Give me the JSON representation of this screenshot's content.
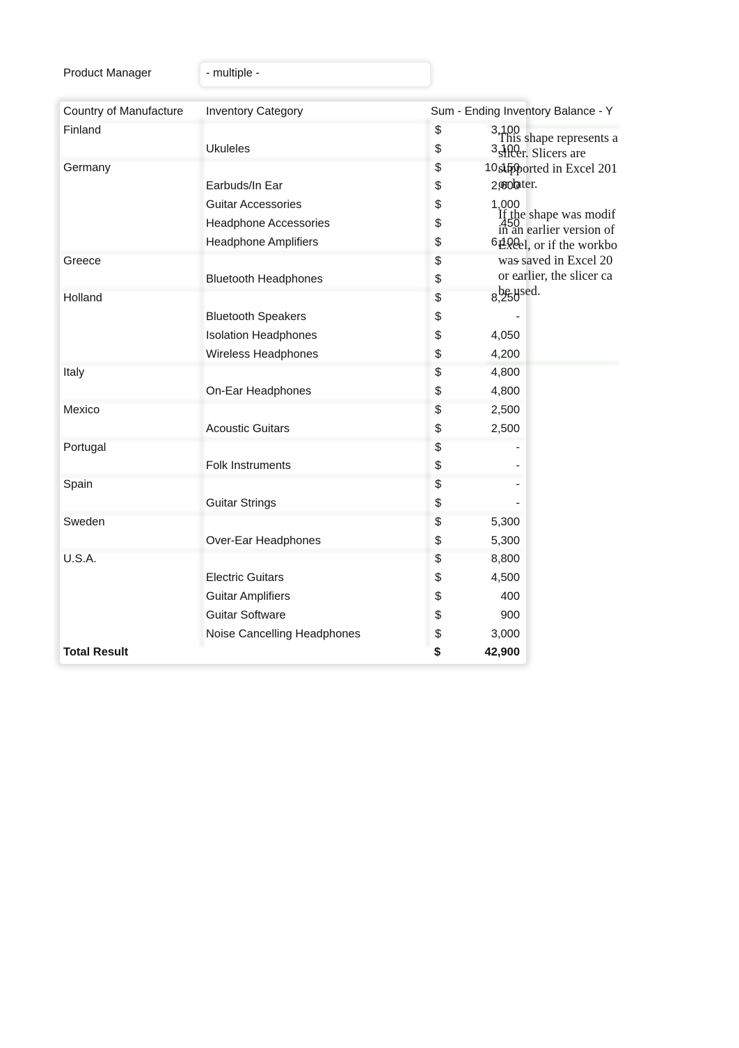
{
  "filter": {
    "label": "Product Manager",
    "value": "- multiple -"
  },
  "pivot": {
    "headers": {
      "country": "Country of Manufacture",
      "category": "Inventory Category",
      "sum": "Sum - Ending Inventory Balance - Y"
    },
    "currency_symbol": "$",
    "rows": [
      {
        "country": "Finland",
        "category": "",
        "value": "3,100"
      },
      {
        "country": "",
        "category": "Ukuleles",
        "value": "3,100"
      },
      {
        "country": "Germany",
        "category": "",
        "value": "10,150"
      },
      {
        "country": "",
        "category": "Earbuds/In Ear",
        "value": "2,600"
      },
      {
        "country": "",
        "category": "Guitar Accessories",
        "value": "1,000"
      },
      {
        "country": "",
        "category": "Headphone Accessories",
        "value": "450"
      },
      {
        "country": "",
        "category": "Headphone Amplifiers",
        "value": "6,100"
      },
      {
        "country": "Greece",
        "category": "",
        "value": "-"
      },
      {
        "country": "",
        "category": "Bluetooth Headphones",
        "value": "-"
      },
      {
        "country": "Holland",
        "category": "",
        "value": "8,250"
      },
      {
        "country": "",
        "category": "Bluetooth Speakers",
        "value": "-"
      },
      {
        "country": "",
        "category": "Isolation Headphones",
        "value": "4,050"
      },
      {
        "country": "",
        "category": "Wireless Headphones",
        "value": "4,200"
      },
      {
        "country": "Italy",
        "category": "",
        "value": "4,800"
      },
      {
        "country": "",
        "category": "On-Ear Headphones",
        "value": "4,800"
      },
      {
        "country": "Mexico",
        "category": "",
        "value": "2,500"
      },
      {
        "country": "",
        "category": "Acoustic Guitars",
        "value": "2,500"
      },
      {
        "country": "Portugal",
        "category": "",
        "value": "-"
      },
      {
        "country": "",
        "category": "Folk Instruments",
        "value": "-"
      },
      {
        "country": "Spain",
        "category": "",
        "value": "-"
      },
      {
        "country": "",
        "category": "Guitar Strings",
        "value": "-"
      },
      {
        "country": "Sweden",
        "category": "",
        "value": "5,300"
      },
      {
        "country": "",
        "category": "Over-Ear Headphones",
        "value": "5,300"
      },
      {
        "country": "U.S.A.",
        "category": "",
        "value": "8,800"
      },
      {
        "country": "",
        "category": "Electric Guitars",
        "value": "4,500"
      },
      {
        "country": "",
        "category": "Guitar Amplifiers",
        "value": "400"
      },
      {
        "country": "",
        "category": "Guitar Software",
        "value": "900"
      },
      {
        "country": "",
        "category": "Noise Cancelling Headphones",
        "value": "3,000"
      }
    ],
    "total": {
      "label": "Total Result",
      "value": "42,900"
    }
  },
  "slicer_placeholder": "This shape represents a\nslicer. Slicers are\nsupported in Excel 201\nor later.\n\nIf the shape was modif\nin an earlier version of\nExcel, or if the workbo\nwas saved in Excel 20\nor earlier, the slicer ca\nbe used."
}
